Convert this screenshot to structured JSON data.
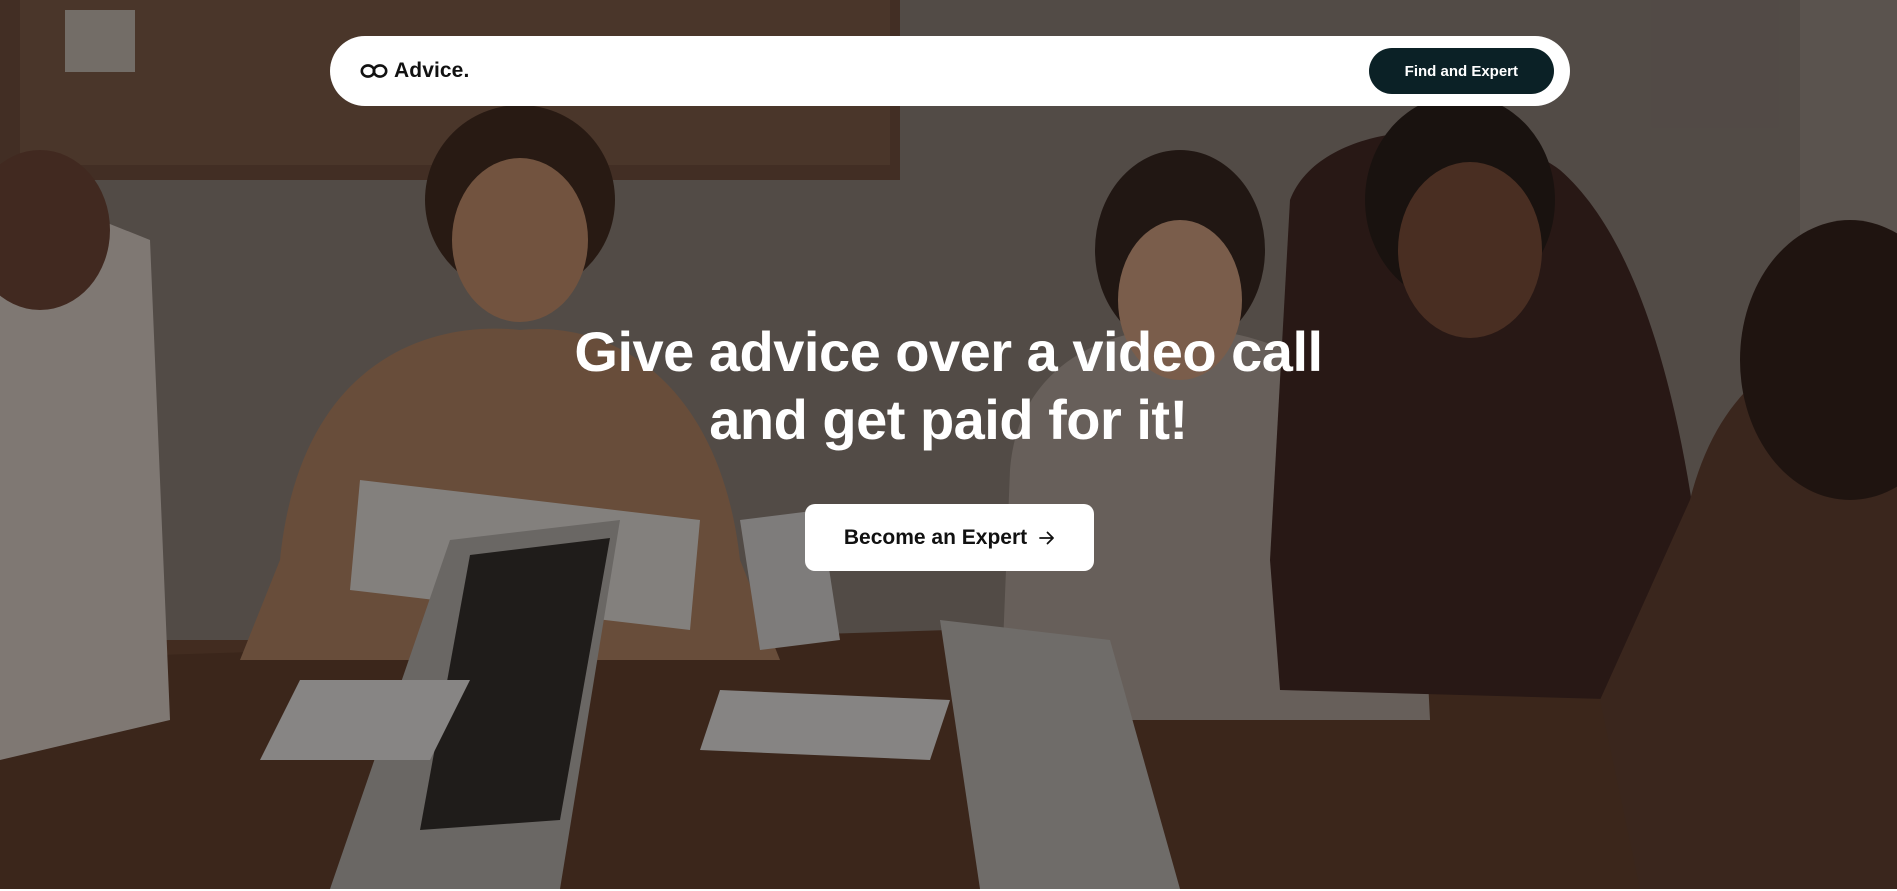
{
  "brand": {
    "name": "Advice.",
    "icon": "infinity-link-icon"
  },
  "nav": {
    "cta_label": "Find and Expert",
    "cta_color": "#0b2126"
  },
  "hero": {
    "headline_line1": "Give advice over a video call",
    "headline_line2": "and get paid for it!",
    "cta_label": "Become an Expert",
    "cta_icon": "arrow-right-icon",
    "background": "photo-team-meeting-around-table"
  }
}
